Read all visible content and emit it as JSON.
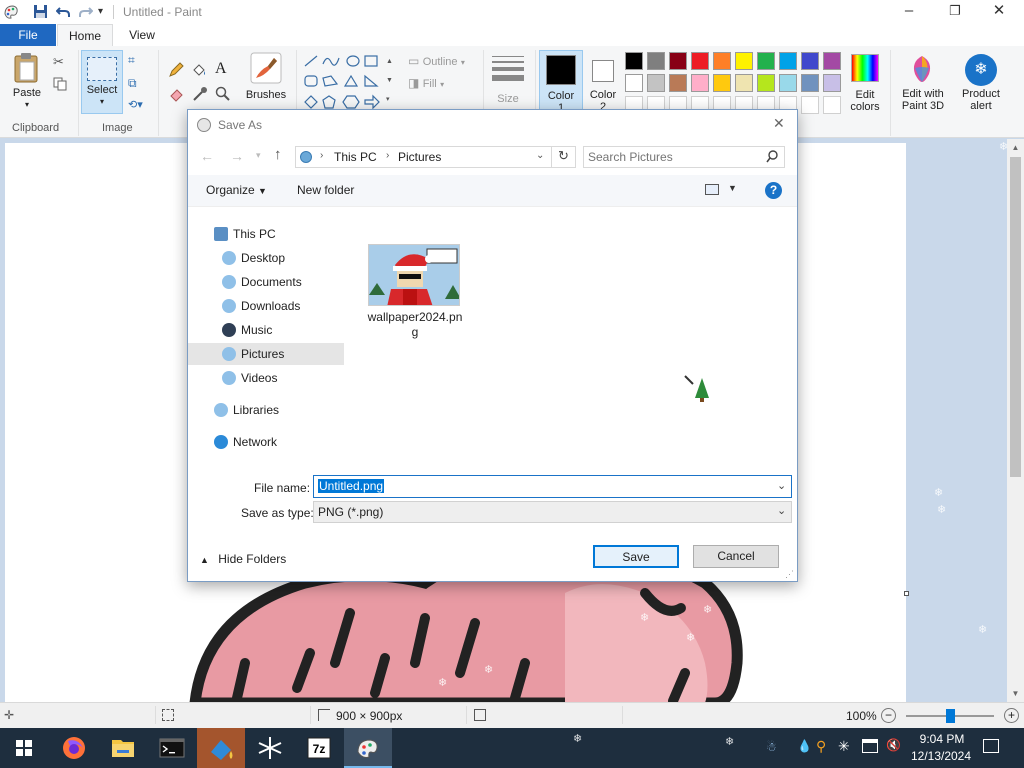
{
  "app": {
    "title": "Untitled - Paint",
    "window_controls": {
      "minimize": "–",
      "maximize": "❐",
      "close": "✕"
    }
  },
  "ribbon": {
    "tabs": [
      "File",
      "Home",
      "View"
    ],
    "clipboard": {
      "paste": "Paste",
      "label": "Clipboard"
    },
    "image": {
      "select": "Select",
      "label": "Image"
    },
    "tools": {
      "brushes": "Brushes",
      "outline": "Outline",
      "fill": "Fill",
      "size": "Size"
    },
    "colors": {
      "color1": "Color 1",
      "color2": "Color 2",
      "color1_value": "#000000",
      "color2_value": "#ffffff",
      "palette_row1": [
        "#000000",
        "#7f7f7f",
        "#880015",
        "#ed1c24",
        "#ff7f27",
        "#fff200",
        "#22b14c",
        "#00a2e8",
        "#3f48cc",
        "#a349a4"
      ],
      "palette_row2": [
        "#ffffff",
        "#c3c3c3",
        "#b97a57",
        "#ffaec9",
        "#ffc90e",
        "#efe4b0",
        "#b5e61d",
        "#99d9ea",
        "#7092be",
        "#c8bfe7"
      ],
      "palette_row3": [
        "#ffffff",
        "#ffffff",
        "#ffffff",
        "#ffffff",
        "#ffffff",
        "#ffffff",
        "#ffffff",
        "#ffffff",
        "#ffffff",
        "#ffffff"
      ],
      "edit_colors": "Edit colors"
    },
    "edit_paint3d": "Edit with Paint 3D",
    "product_alert": "Product alert"
  },
  "dialog": {
    "title": "Save As",
    "breadcrumb": [
      "This PC",
      "Pictures"
    ],
    "search_placeholder": "Search Pictures",
    "organize": "Organize",
    "new_folder": "New folder",
    "nav": [
      "This PC",
      "Desktop",
      "Documents",
      "Downloads",
      "Music",
      "Pictures",
      "Videos",
      "Libraries",
      "Network"
    ],
    "selected_nav": "Pictures",
    "files": [
      {
        "name": "wallpaper2024.png"
      }
    ],
    "file_name_label": "File name:",
    "file_name_value": "Untitled.png",
    "save_type_label": "Save as type:",
    "save_type_value": "PNG (*.png)",
    "hide_folders": "Hide Folders",
    "save": "Save",
    "cancel": "Cancel"
  },
  "status": {
    "dimensions": "900 × 900px",
    "zoom": "100%",
    "zoom_level": 0.5
  },
  "taskbar": {
    "time": "9:04 PM",
    "date": "12/13/2024"
  }
}
